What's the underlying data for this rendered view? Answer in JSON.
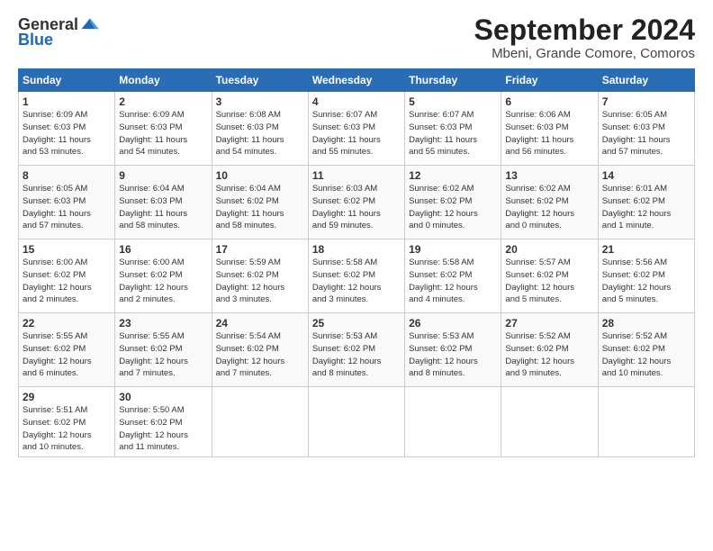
{
  "header": {
    "logo_line1": "General",
    "logo_line2": "Blue",
    "main_title": "September 2024",
    "subtitle": "Mbeni, Grande Comore, Comoros"
  },
  "weekdays": [
    "Sunday",
    "Monday",
    "Tuesday",
    "Wednesday",
    "Thursday",
    "Friday",
    "Saturday"
  ],
  "weeks": [
    [
      {
        "day": "1",
        "info": "Sunrise: 6:09 AM\nSunset: 6:03 PM\nDaylight: 11 hours\nand 53 minutes."
      },
      {
        "day": "2",
        "info": "Sunrise: 6:09 AM\nSunset: 6:03 PM\nDaylight: 11 hours\nand 54 minutes."
      },
      {
        "day": "3",
        "info": "Sunrise: 6:08 AM\nSunset: 6:03 PM\nDaylight: 11 hours\nand 54 minutes."
      },
      {
        "day": "4",
        "info": "Sunrise: 6:07 AM\nSunset: 6:03 PM\nDaylight: 11 hours\nand 55 minutes."
      },
      {
        "day": "5",
        "info": "Sunrise: 6:07 AM\nSunset: 6:03 PM\nDaylight: 11 hours\nand 55 minutes."
      },
      {
        "day": "6",
        "info": "Sunrise: 6:06 AM\nSunset: 6:03 PM\nDaylight: 11 hours\nand 56 minutes."
      },
      {
        "day": "7",
        "info": "Sunrise: 6:05 AM\nSunset: 6:03 PM\nDaylight: 11 hours\nand 57 minutes."
      }
    ],
    [
      {
        "day": "8",
        "info": "Sunrise: 6:05 AM\nSunset: 6:03 PM\nDaylight: 11 hours\nand 57 minutes."
      },
      {
        "day": "9",
        "info": "Sunrise: 6:04 AM\nSunset: 6:03 PM\nDaylight: 11 hours\nand 58 minutes."
      },
      {
        "day": "10",
        "info": "Sunrise: 6:04 AM\nSunset: 6:02 PM\nDaylight: 11 hours\nand 58 minutes."
      },
      {
        "day": "11",
        "info": "Sunrise: 6:03 AM\nSunset: 6:02 PM\nDaylight: 11 hours\nand 59 minutes."
      },
      {
        "day": "12",
        "info": "Sunrise: 6:02 AM\nSunset: 6:02 PM\nDaylight: 12 hours\nand 0 minutes."
      },
      {
        "day": "13",
        "info": "Sunrise: 6:02 AM\nSunset: 6:02 PM\nDaylight: 12 hours\nand 0 minutes."
      },
      {
        "day": "14",
        "info": "Sunrise: 6:01 AM\nSunset: 6:02 PM\nDaylight: 12 hours\nand 1 minute."
      }
    ],
    [
      {
        "day": "15",
        "info": "Sunrise: 6:00 AM\nSunset: 6:02 PM\nDaylight: 12 hours\nand 2 minutes."
      },
      {
        "day": "16",
        "info": "Sunrise: 6:00 AM\nSunset: 6:02 PM\nDaylight: 12 hours\nand 2 minutes."
      },
      {
        "day": "17",
        "info": "Sunrise: 5:59 AM\nSunset: 6:02 PM\nDaylight: 12 hours\nand 3 minutes."
      },
      {
        "day": "18",
        "info": "Sunrise: 5:58 AM\nSunset: 6:02 PM\nDaylight: 12 hours\nand 3 minutes."
      },
      {
        "day": "19",
        "info": "Sunrise: 5:58 AM\nSunset: 6:02 PM\nDaylight: 12 hours\nand 4 minutes."
      },
      {
        "day": "20",
        "info": "Sunrise: 5:57 AM\nSunset: 6:02 PM\nDaylight: 12 hours\nand 5 minutes."
      },
      {
        "day": "21",
        "info": "Sunrise: 5:56 AM\nSunset: 6:02 PM\nDaylight: 12 hours\nand 5 minutes."
      }
    ],
    [
      {
        "day": "22",
        "info": "Sunrise: 5:55 AM\nSunset: 6:02 PM\nDaylight: 12 hours\nand 6 minutes."
      },
      {
        "day": "23",
        "info": "Sunrise: 5:55 AM\nSunset: 6:02 PM\nDaylight: 12 hours\nand 7 minutes."
      },
      {
        "day": "24",
        "info": "Sunrise: 5:54 AM\nSunset: 6:02 PM\nDaylight: 12 hours\nand 7 minutes."
      },
      {
        "day": "25",
        "info": "Sunrise: 5:53 AM\nSunset: 6:02 PM\nDaylight: 12 hours\nand 8 minutes."
      },
      {
        "day": "26",
        "info": "Sunrise: 5:53 AM\nSunset: 6:02 PM\nDaylight: 12 hours\nand 8 minutes."
      },
      {
        "day": "27",
        "info": "Sunrise: 5:52 AM\nSunset: 6:02 PM\nDaylight: 12 hours\nand 9 minutes."
      },
      {
        "day": "28",
        "info": "Sunrise: 5:52 AM\nSunset: 6:02 PM\nDaylight: 12 hours\nand 10 minutes."
      }
    ],
    [
      {
        "day": "29",
        "info": "Sunrise: 5:51 AM\nSunset: 6:02 PM\nDaylight: 12 hours\nand 10 minutes."
      },
      {
        "day": "30",
        "info": "Sunrise: 5:50 AM\nSunset: 6:02 PM\nDaylight: 12 hours\nand 11 minutes."
      },
      {
        "day": "",
        "info": ""
      },
      {
        "day": "",
        "info": ""
      },
      {
        "day": "",
        "info": ""
      },
      {
        "day": "",
        "info": ""
      },
      {
        "day": "",
        "info": ""
      }
    ]
  ]
}
